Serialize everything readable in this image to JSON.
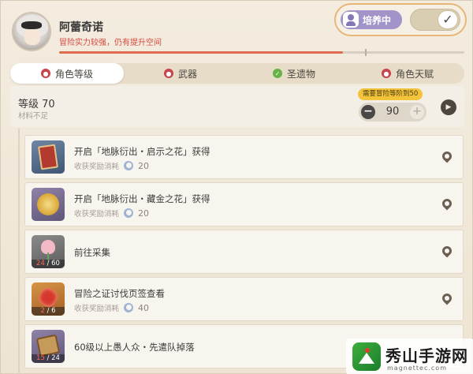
{
  "header": {
    "character_name": "阿蕾奇诺",
    "status_text": "冒险实力较强，仍有提升空间",
    "progress_fraction": 0.7,
    "cultivate_label": "培养中",
    "toggle_checked": true,
    "toggle_glyph": "✓"
  },
  "tabs": [
    {
      "label": "角色等级",
      "status": "red"
    },
    {
      "label": "武器",
      "status": "red"
    },
    {
      "label": "圣遗物",
      "status": "green"
    },
    {
      "label": "角色天赋",
      "status": "red"
    }
  ],
  "level": {
    "title": "等级 70",
    "subtitle": "材料不足",
    "requirement_badge": "需要冒险等阶到50",
    "target_value": "90",
    "minus": "−",
    "plus": "+",
    "go_glyph": "▶"
  },
  "tasks": [
    {
      "title": "开启「地脉衍出・启示之花」获得",
      "reward_label": "收获奖励消耗",
      "reward_value": "20",
      "thumb": "blue",
      "icon": "book-icon"
    },
    {
      "title": "开启「地脉衍出・藏金之花」获得",
      "reward_label": "收获奖励消耗",
      "reward_value": "20",
      "thumb": "purple",
      "icon": "coin-icon"
    },
    {
      "title": "前往采集",
      "thumb": "gray",
      "icon": "flower-icon",
      "have": "24",
      "need": "/ 60"
    },
    {
      "title": "冒险之证讨伐页签查看",
      "reward_label": "收获奖励消耗",
      "reward_value": "40",
      "thumb": "orange",
      "icon": "gem-icon",
      "have": "2",
      "need": "/ 6"
    },
    {
      "title": "60级以上愚人众・先遣队掉落",
      "thumb": "purple",
      "icon": "scroll-icon",
      "have": "15",
      "need": "/ 24"
    }
  ],
  "watermark": {
    "title": "秀山手游网",
    "url": "magnettec.com"
  },
  "colors": {
    "accent_red": "#d5493f",
    "badge_purple": "#a293c9",
    "badge_yellow": "#f3c33a"
  }
}
